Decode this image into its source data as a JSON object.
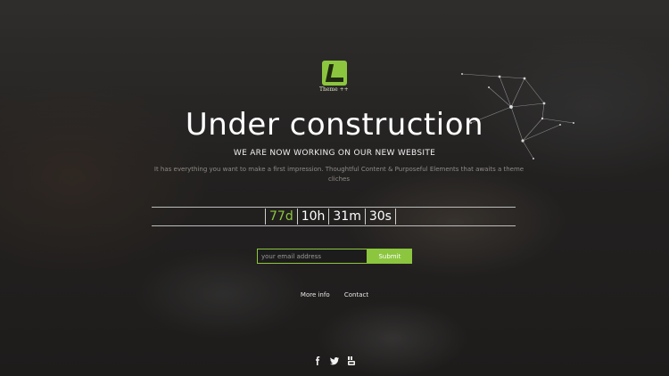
{
  "logo": {
    "tagline": "Theme ++",
    "icon": "l-letter-logo-icon",
    "color": "#8cc63f"
  },
  "hero": {
    "title": "Under construction",
    "subtitle": "WE ARE NOW WORKING ON OUR NEW WEBSITE",
    "description": "It has everything you want to make a first impression. Thoughtful Content & Purposeful Elements that awaits a theme cliches"
  },
  "countdown": {
    "days": "77d",
    "hours": "10h",
    "minutes": "31m",
    "seconds": "30s"
  },
  "newsletter": {
    "email_placeholder": "your email address",
    "submit_label": "Submit"
  },
  "footer_links": {
    "more_info": "More info",
    "contact": "Contact"
  },
  "social": [
    "facebook-icon",
    "twitter-icon",
    "youtube-icon"
  ],
  "colors": {
    "accent": "#8cc63f",
    "text": "#ffffff",
    "muted": "#8e8a86"
  }
}
